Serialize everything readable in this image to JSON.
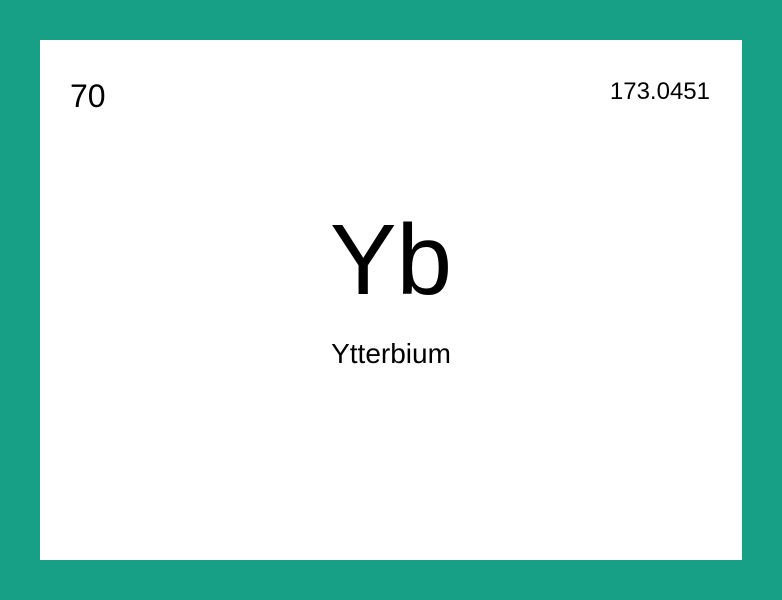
{
  "element": {
    "atomic_number": "70",
    "atomic_mass": "173.0451",
    "symbol": "Yb",
    "name": "Ytterbium"
  },
  "colors": {
    "frame_background": "#17a085",
    "card_background": "#ffffff",
    "text": "#000000"
  }
}
